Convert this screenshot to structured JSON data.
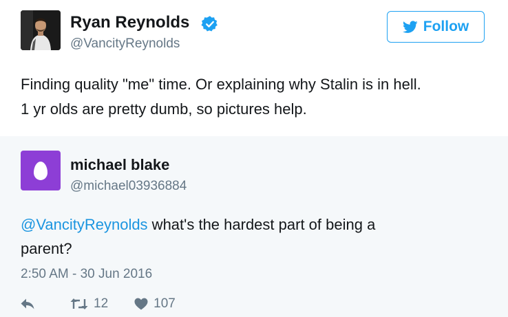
{
  "main_tweet": {
    "author_name": "Ryan Reynolds",
    "author_handle": "@VancityReynolds",
    "verified": true,
    "follow_label": "Follow",
    "text_line1": "Finding quality \"me\" time. Or explaining why Stalin is in hell.",
    "text_line2": "1 yr olds are pretty dumb, so pictures help."
  },
  "reply_tweet": {
    "author_name": "michael blake",
    "author_handle": "@michael03936884",
    "mention": "@VancityReynolds",
    "text_rest": " what's the hardest part of being a",
    "text_line2": "parent?",
    "timestamp": "2:50 AM - 30 Jun 2016",
    "retweet_count": "12",
    "like_count": "107"
  },
  "icons": {
    "verified": "verified-badge-icon",
    "follow": "twitter-bird-icon",
    "reply": "reply-arrow-icon",
    "retweet": "retweet-icon",
    "like": "heart-icon"
  },
  "colors": {
    "accent": "#1da1f2",
    "mention": "#1b95e0",
    "muted_text": "#657786",
    "reply_background": "#f5f8fa",
    "default_avatar": "#8d3ed6"
  }
}
